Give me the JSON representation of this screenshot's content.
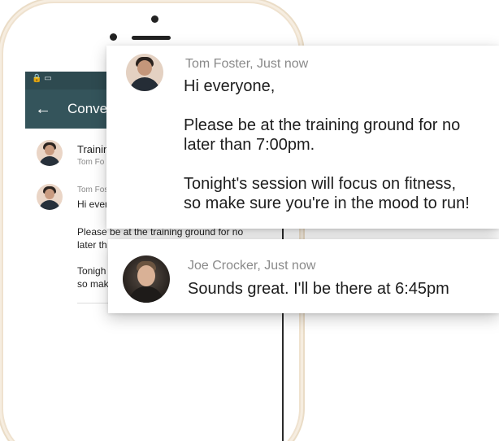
{
  "app": {
    "title": "Conve"
  },
  "status_bar": {
    "icons": [
      "lock-icon",
      "sim-icon"
    ],
    "text": "🔒 ▭"
  },
  "app_bar": {
    "back_icon": "arrow-left-icon",
    "back_glyph": "←"
  },
  "conversation_list": {
    "item": {
      "title": "Trainin",
      "subtitle": "Tom Fo"
    }
  },
  "message_thread": {
    "sender": "Tom Fos",
    "greeting": "Hi ever",
    "lines": [
      "Please be at the training ground for no",
      "later th",
      "Tonigh",
      "so mak"
    ]
  },
  "cards": {
    "tom": {
      "sender_line": "Tom Foster, Just now",
      "lines": [
        "Hi everyone,",
        "",
        "Please be at the training ground for no",
        "later than 7:00pm.",
        "",
        "Tonight's session will focus on fitness,",
        "so make sure you're in the mood to run!"
      ]
    },
    "joe": {
      "sender_line": "Joe Crocker, Just now",
      "text": "Sounds great. I'll be there at 6:45pm"
    }
  },
  "colors": {
    "app_bar": "#34545b",
    "status_bar": "#2e4a50",
    "phone_frame": "#eadcc6"
  }
}
